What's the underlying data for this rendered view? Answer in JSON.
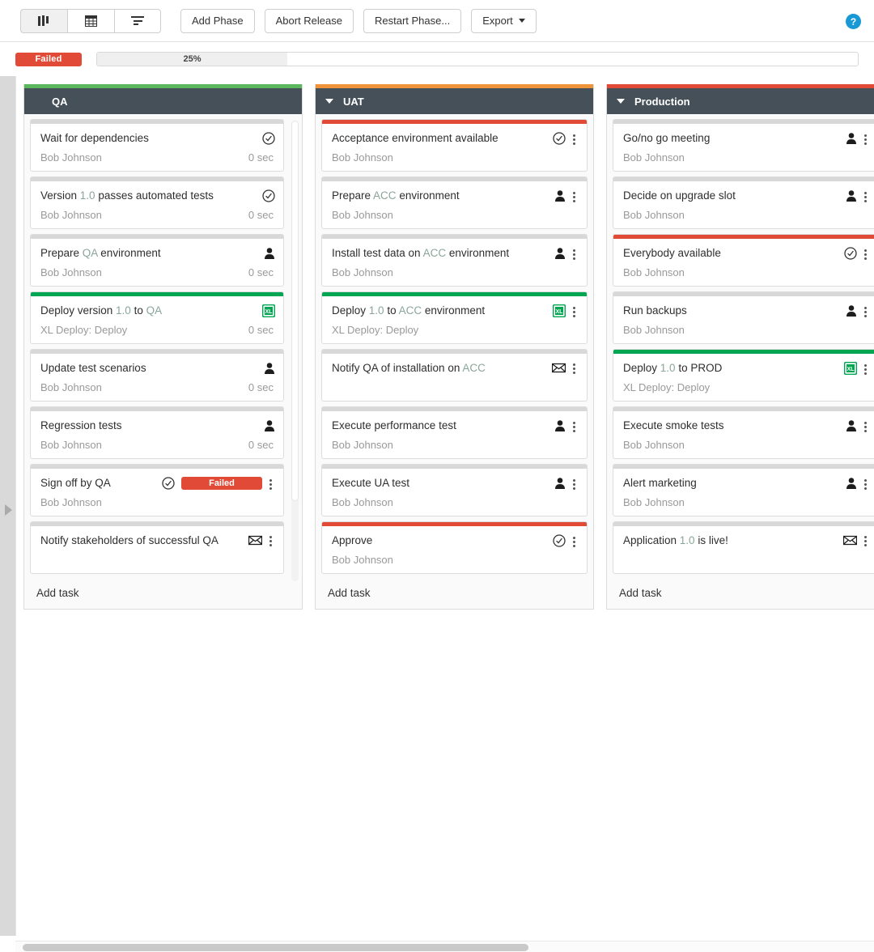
{
  "toolbar": {
    "view_buttons": [
      {
        "name": "kanban-view",
        "icon": "columns-icon",
        "active": true
      },
      {
        "name": "table-view",
        "icon": "table-icon",
        "active": false
      },
      {
        "name": "flow-view",
        "icon": "list-flow-icon",
        "active": false
      }
    ],
    "add_phase_label": "Add Phase",
    "abort_release_label": "Abort Release",
    "restart_phase_label": "Restart Phase...",
    "export_label": "Export",
    "help_label": "?"
  },
  "status": {
    "badge": "Failed",
    "badge_color": "#e04a36",
    "progress_percent": 25,
    "progress_label": "25%"
  },
  "board": {
    "add_task_label": "Add task",
    "phases": [
      {
        "title": "QA",
        "accent_color": "#5cb85c",
        "has_caret": false,
        "tasks": [
          {
            "title_parts": [
              {
                "t": "Wait for dependencies",
                "v": false
              }
            ],
            "owner": "Bob Johnson",
            "duration": "0 sec",
            "accent": "gray",
            "icons": [
              "check-circle-icon"
            ],
            "kebab": false
          },
          {
            "title_parts": [
              {
                "t": "Version ",
                "v": false
              },
              {
                "t": "1.0",
                "v": true
              },
              {
                "t": " passes automated tests",
                "v": false
              }
            ],
            "owner": "Bob Johnson",
            "duration": "0 sec",
            "accent": "gray",
            "icons": [
              "check-circle-icon"
            ],
            "kebab": false
          },
          {
            "title_parts": [
              {
                "t": "Prepare ",
                "v": false
              },
              {
                "t": "QA",
                "v": true
              },
              {
                "t": " environment",
                "v": false
              }
            ],
            "owner": "Bob Johnson",
            "duration": "0 sec",
            "accent": "gray",
            "icons": [
              "user-icon"
            ],
            "kebab": false
          },
          {
            "title_parts": [
              {
                "t": "Deploy version ",
                "v": false
              },
              {
                "t": "1.0",
                "v": true
              },
              {
                "t": " to ",
                "v": false
              },
              {
                "t": "QA",
                "v": true
              }
            ],
            "owner": "XL Deploy: Deploy",
            "duration": "0 sec",
            "accent": "green",
            "icons": [
              "xl-deploy-icon"
            ],
            "kebab": false
          },
          {
            "title_parts": [
              {
                "t": "Update test scenarios",
                "v": false
              }
            ],
            "owner": "Bob Johnson",
            "duration": "0 sec",
            "accent": "gray",
            "icons": [
              "user-icon"
            ],
            "kebab": false
          },
          {
            "title_parts": [
              {
                "t": "Regression tests",
                "v": false
              }
            ],
            "owner": "Bob Johnson",
            "duration": "0 sec",
            "accent": "gray",
            "icons": [
              "user-icon"
            ],
            "kebab": false
          },
          {
            "title_parts": [
              {
                "t": "Sign off by QA",
                "v": false
              }
            ],
            "owner": "Bob Johnson",
            "duration": "",
            "accent": "gray",
            "icons": [
              "check-circle-icon"
            ],
            "badge": "Failed",
            "kebab": true
          },
          {
            "title_parts": [
              {
                "t": "Notify stakeholders of successful QA",
                "v": false
              }
            ],
            "owner": "",
            "duration": "",
            "accent": "gray",
            "icons": [
              "envelope-icon"
            ],
            "kebab": true
          }
        ]
      },
      {
        "title": "UAT",
        "accent_color": "#f0943c",
        "has_caret": true,
        "tasks": [
          {
            "title_parts": [
              {
                "t": "Acceptance environment available",
                "v": false
              }
            ],
            "owner": "Bob Johnson",
            "duration": "",
            "accent": "red",
            "icons": [
              "check-circle-icon"
            ],
            "kebab": true
          },
          {
            "title_parts": [
              {
                "t": "Prepare ",
                "v": false
              },
              {
                "t": "ACC",
                "v": true
              },
              {
                "t": " environment",
                "v": false
              }
            ],
            "owner": "Bob Johnson",
            "duration": "",
            "accent": "gray",
            "icons": [
              "user-icon"
            ],
            "kebab": true
          },
          {
            "title_parts": [
              {
                "t": "Install test data on ",
                "v": false
              },
              {
                "t": "ACC",
                "v": true
              },
              {
                "t": " environment",
                "v": false
              }
            ],
            "owner": "Bob Johnson",
            "duration": "",
            "accent": "gray",
            "icons": [
              "user-icon"
            ],
            "kebab": true
          },
          {
            "title_parts": [
              {
                "t": "Deploy ",
                "v": false
              },
              {
                "t": "1.0",
                "v": true
              },
              {
                "t": " to ",
                "v": false
              },
              {
                "t": "ACC",
                "v": true
              },
              {
                "t": " environment",
                "v": false
              }
            ],
            "owner": "XL Deploy: Deploy",
            "duration": "",
            "accent": "green",
            "icons": [
              "xl-deploy-icon"
            ],
            "kebab": true
          },
          {
            "title_parts": [
              {
                "t": "Notify QA of installation on ",
                "v": false
              },
              {
                "t": "ACC",
                "v": true
              }
            ],
            "owner": "",
            "duration": "",
            "accent": "gray",
            "icons": [
              "envelope-icon"
            ],
            "kebab": true
          },
          {
            "title_parts": [
              {
                "t": "Execute performance test",
                "v": false
              }
            ],
            "owner": "Bob Johnson",
            "duration": "",
            "accent": "gray",
            "icons": [
              "user-icon"
            ],
            "kebab": true
          },
          {
            "title_parts": [
              {
                "t": "Execute UA test",
                "v": false
              }
            ],
            "owner": "Bob Johnson",
            "duration": "",
            "accent": "gray",
            "icons": [
              "user-icon"
            ],
            "kebab": true
          },
          {
            "title_parts": [
              {
                "t": "Approve",
                "v": false
              }
            ],
            "owner": "Bob Johnson",
            "duration": "",
            "accent": "red",
            "icons": [
              "check-circle-icon"
            ],
            "kebab": true
          }
        ]
      },
      {
        "title": "Production",
        "accent_color": "#e04a36",
        "has_caret": true,
        "tasks": [
          {
            "title_parts": [
              {
                "t": "Go/no go meeting",
                "v": false
              }
            ],
            "owner": "Bob Johnson",
            "duration": "",
            "accent": "gray",
            "icons": [
              "user-icon"
            ],
            "kebab": true
          },
          {
            "title_parts": [
              {
                "t": "Decide on upgrade slot",
                "v": false
              }
            ],
            "owner": "Bob Johnson",
            "duration": "",
            "accent": "gray",
            "icons": [
              "user-icon"
            ],
            "kebab": true
          },
          {
            "title_parts": [
              {
                "t": "Everybody available",
                "v": false
              }
            ],
            "owner": "Bob Johnson",
            "duration": "",
            "accent": "red",
            "icons": [
              "check-circle-icon"
            ],
            "kebab": true
          },
          {
            "title_parts": [
              {
                "t": "Run backups",
                "v": false
              }
            ],
            "owner": "Bob Johnson",
            "duration": "",
            "accent": "gray",
            "icons": [
              "user-icon"
            ],
            "kebab": true
          },
          {
            "title_parts": [
              {
                "t": "Deploy ",
                "v": false
              },
              {
                "t": "1.0",
                "v": true
              },
              {
                "t": " to PROD",
                "v": false
              }
            ],
            "owner": "XL Deploy: Deploy",
            "duration": "",
            "accent": "green",
            "icons": [
              "xl-deploy-icon"
            ],
            "kebab": true
          },
          {
            "title_parts": [
              {
                "t": "Execute smoke tests",
                "v": false
              }
            ],
            "owner": "Bob Johnson",
            "duration": "",
            "accent": "gray",
            "icons": [
              "user-icon"
            ],
            "kebab": true
          },
          {
            "title_parts": [
              {
                "t": "Alert marketing",
                "v": false
              }
            ],
            "owner": "Bob Johnson",
            "duration": "",
            "accent": "gray",
            "icons": [
              "user-icon"
            ],
            "kebab": true
          },
          {
            "title_parts": [
              {
                "t": "Application ",
                "v": false
              },
              {
                "t": "1.0",
                "v": true
              },
              {
                "t": " is live!",
                "v": false
              }
            ],
            "owner": "",
            "duration": "",
            "accent": "gray",
            "icons": [
              "envelope-icon"
            ],
            "kebab": true
          }
        ]
      }
    ]
  }
}
